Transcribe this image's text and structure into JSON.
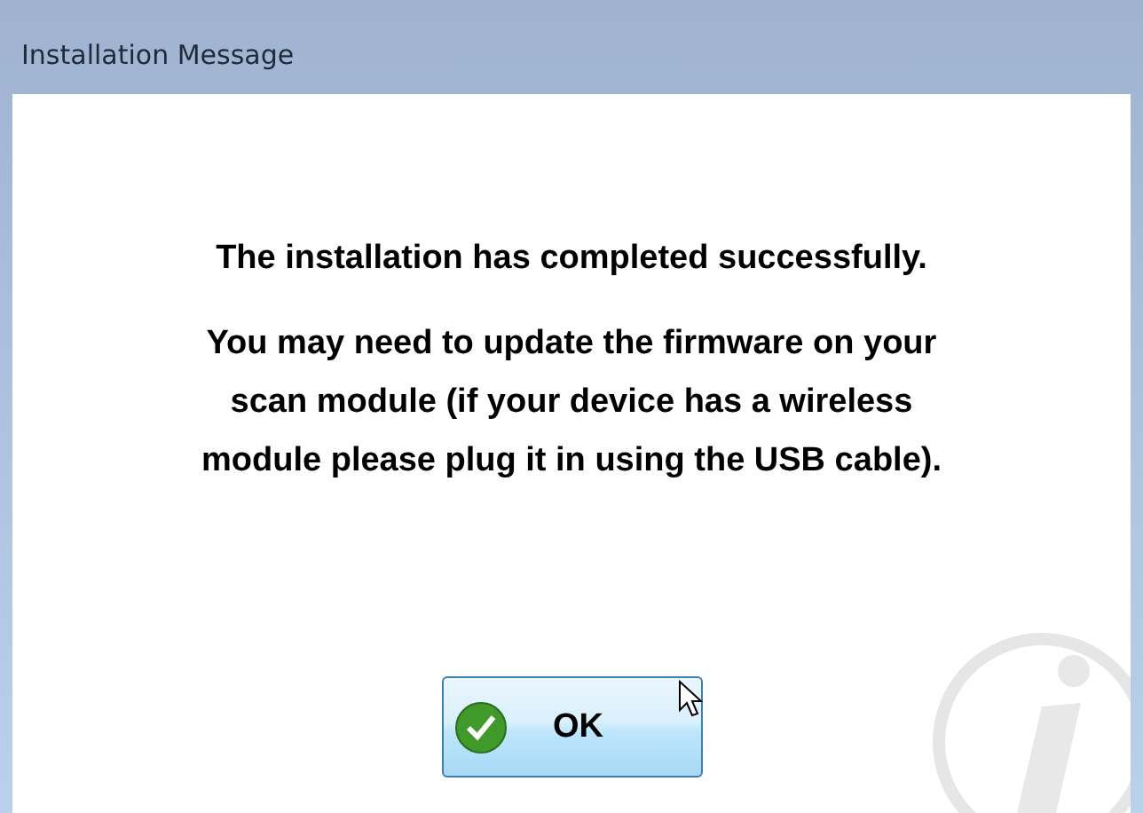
{
  "window": {
    "title": "Installation Message"
  },
  "message": [
    [
      "The installation has completed successfully."
    ],
    [
      "You may need to update the firmware on your",
      "scan module (if your device has a wireless",
      "module please plug it in using the USB cable)."
    ]
  ],
  "buttons": [
    {
      "label": "OK",
      "kind": "ok",
      "hovered": true
    }
  ]
}
